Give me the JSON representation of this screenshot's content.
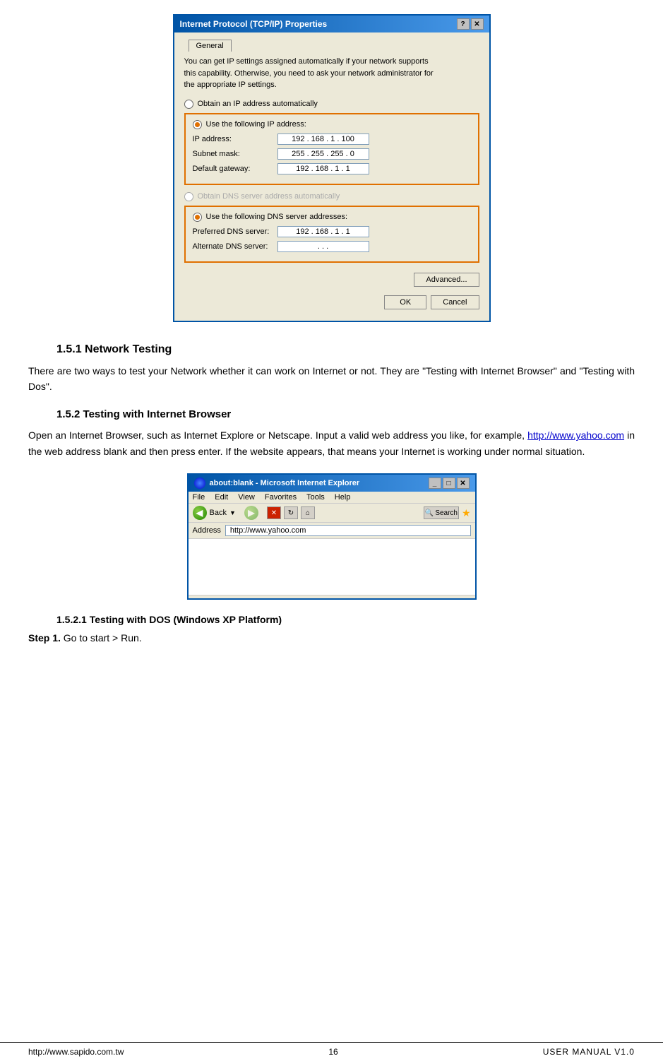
{
  "dialog": {
    "title": "Internet Protocol (TCP/IP) Properties",
    "tab": "General",
    "info_text": "You can get IP settings assigned automatically if your network supports\nthis capability. Otherwise, you need to ask your network administrator for\nthe appropriate IP settings.",
    "radio_auto_ip": "Obtain an IP address automatically",
    "radio_manual_ip": "Use the following IP address:",
    "ip_address_label": "IP address:",
    "ip_address_value": "192 . 168 . 1 . 100",
    "subnet_label": "Subnet mask:",
    "subnet_value": "255 . 255 . 255 . 0",
    "gateway_label": "Default gateway:",
    "gateway_value": "192 . 168 . 1 . 1",
    "radio_auto_dns": "Obtain DNS server address automatically",
    "radio_manual_dns": "Use the following DNS server addresses:",
    "preferred_dns_label": "Preferred DNS server:",
    "preferred_dns_value": "192 . 168 . 1 . 1",
    "alternate_dns_label": "Alternate DNS server:",
    "alternate_dns_value": ". . .",
    "btn_advanced": "Advanced...",
    "btn_ok": "OK",
    "btn_cancel": "Cancel"
  },
  "section_1_5_1": {
    "heading": "1.5.1    Network Testing",
    "body": "There are two ways to test your Network whether it can work on Internet or not. They are \"Testing with Internet Browser\" and \"Testing with Dos\"."
  },
  "section_1_5_2": {
    "heading": "1.5.2    Testing with Internet Browser",
    "body1": "Open an Internet Browser, such as Internet Explore or Netscape.   Input a valid web address you like, for example,",
    "link": "http://www.yahoo.com",
    "body2": " in the web address blank and then press enter.   If the website appears, that means your Internet is working under normal situation."
  },
  "ie_window": {
    "title": "about:blank - Microsoft Internet Explorer",
    "menu_items": [
      "File",
      "Edit",
      "View",
      "Favorites",
      "Tools",
      "Help"
    ],
    "back_label": "Back",
    "address_label": "Address",
    "address_value": "http://www.yahoo.com"
  },
  "section_1_5_2_1": {
    "heading": "1.5.2.1    Testing with DOS (Windows XP Platform)",
    "step1_label": "Step 1.",
    "step1_text": "   Go to start > Run."
  },
  "footer": {
    "url": "http://www.sapido.com.tw",
    "page": "16",
    "manual": "USER MANUAL V1.0"
  }
}
